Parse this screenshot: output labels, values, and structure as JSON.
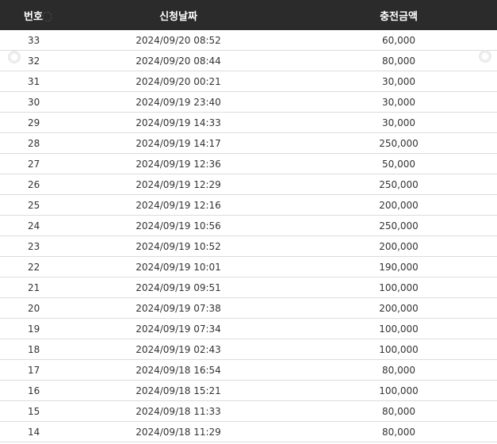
{
  "table": {
    "headers": {
      "number": "번호",
      "date": "신청날짜",
      "amount": "충전금액"
    },
    "rows": [
      {
        "number": "33",
        "date": "2024/09/20 08:52",
        "amount": "60,000"
      },
      {
        "number": "32",
        "date": "2024/09/20 08:44",
        "amount": "80,000"
      },
      {
        "number": "31",
        "date": "2024/09/20 00:21",
        "amount": "30,000"
      },
      {
        "number": "30",
        "date": "2024/09/19 23:40",
        "amount": "30,000"
      },
      {
        "number": "29",
        "date": "2024/09/19 14:33",
        "amount": "30,000"
      },
      {
        "number": "28",
        "date": "2024/09/19 14:17",
        "amount": "250,000"
      },
      {
        "number": "27",
        "date": "2024/09/19 12:36",
        "amount": "50,000"
      },
      {
        "number": "26",
        "date": "2024/09/19 12:29",
        "amount": "250,000"
      },
      {
        "number": "25",
        "date": "2024/09/19 12:16",
        "amount": "200,000"
      },
      {
        "number": "24",
        "date": "2024/09/19 10:56",
        "amount": "250,000"
      },
      {
        "number": "23",
        "date": "2024/09/19 10:52",
        "amount": "200,000"
      },
      {
        "number": "22",
        "date": "2024/09/19 10:01",
        "amount": "190,000"
      },
      {
        "number": "21",
        "date": "2024/09/19 09:51",
        "amount": "100,000"
      },
      {
        "number": "20",
        "date": "2024/09/19 07:38",
        "amount": "200,000"
      },
      {
        "number": "19",
        "date": "2024/09/19 07:34",
        "amount": "100,000"
      },
      {
        "number": "18",
        "date": "2024/09/19 02:43",
        "amount": "100,000"
      },
      {
        "number": "17",
        "date": "2024/09/18 16:54",
        "amount": "80,000"
      },
      {
        "number": "16",
        "date": "2024/09/18 15:21",
        "amount": "100,000"
      },
      {
        "number": "15",
        "date": "2024/09/18 11:33",
        "amount": "80,000"
      },
      {
        "number": "14",
        "date": "2024/09/18 11:29",
        "amount": "80,000"
      }
    ]
  },
  "colors": {
    "header_bg": "#2b2b2b",
    "header_text": "#ffffff",
    "row_text": "#333333",
    "row_border": "#dcdcdc"
  },
  "icons": [
    "watermark-badge-icon"
  ]
}
